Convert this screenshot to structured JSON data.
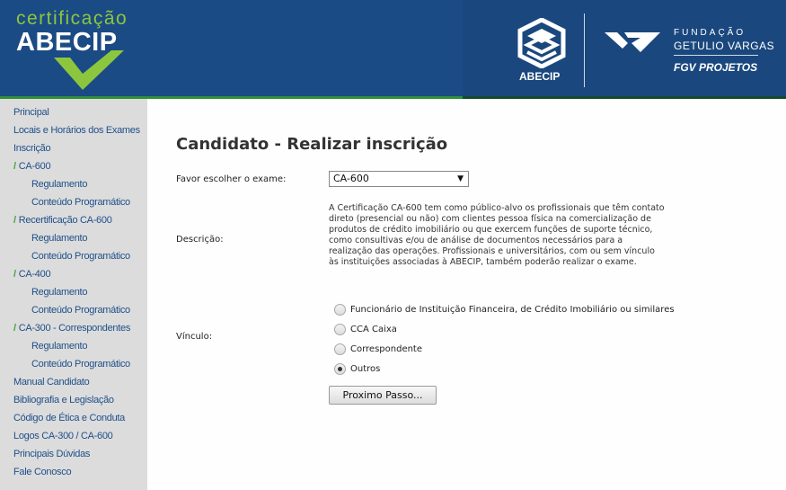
{
  "header": {
    "cert_small": "certificação",
    "cert_big": "ABECIP",
    "abecip_label": "ABECIP",
    "fgv_line1": "FUNDAÇÃO",
    "fgv_line2": "GETULIO VARGAS",
    "fgv_line3": "FGV PROJETOS"
  },
  "colors": {
    "header_blue": "#1b4b84",
    "brand_green": "#8cc63f",
    "nav_link": "#1f4f8a",
    "sidebar_bg": "#dcdcdc"
  },
  "sidebar": {
    "items": [
      {
        "label": "Principal",
        "level": 0,
        "checked": false
      },
      {
        "label": "Locais e Horários dos Exames",
        "level": 0,
        "checked": false
      },
      {
        "label": "Inscrição",
        "level": 0,
        "checked": false
      },
      {
        "label": "CA-600",
        "level": 0,
        "checked": true
      },
      {
        "label": "Regulamento",
        "level": 1,
        "checked": false
      },
      {
        "label": "Conteúdo Programático",
        "level": 1,
        "checked": false
      },
      {
        "label": "Recertificação CA-600",
        "level": 0,
        "checked": true
      },
      {
        "label": "Regulamento",
        "level": 1,
        "checked": false
      },
      {
        "label": "Conteúdo Programático",
        "level": 1,
        "checked": false
      },
      {
        "label": "CA-400",
        "level": 0,
        "checked": true
      },
      {
        "label": "Regulamento",
        "level": 1,
        "checked": false
      },
      {
        "label": "Conteúdo Programático",
        "level": 1,
        "checked": false
      },
      {
        "label": "CA-300 - Correspondentes",
        "level": 0,
        "checked": true
      },
      {
        "label": "Regulamento",
        "level": 1,
        "checked": false
      },
      {
        "label": "Conteúdo Programático",
        "level": 1,
        "checked": false
      },
      {
        "label": "Manual Candidato",
        "level": 0,
        "checked": false
      },
      {
        "label": "Bibliografia e Legislação",
        "level": 0,
        "checked": false
      },
      {
        "label": "Código de Ética e Conduta",
        "level": 0,
        "checked": false
      },
      {
        "label": "Logos CA-300 / CA-600",
        "level": 0,
        "checked": false
      },
      {
        "label": "Principais Dúvidas",
        "level": 0,
        "checked": false
      },
      {
        "label": "Fale Conosco",
        "level": 0,
        "checked": false
      }
    ]
  },
  "main": {
    "title": "Candidato - Realizar inscrição",
    "exam_label": "Favor escolher o exame:",
    "exam_selected": "CA-600",
    "description_label": "Descrição:",
    "description_text": "A Certificação CA-600 tem como público-alvo os profissionais que têm contato direto (presencial ou não) com clientes pessoa física na comercialização de produtos de crédito imobiliário ou que exercem funções de suporte técnico, como consultivas e/ou de análise de documentos necessários para a realização das operações. Profissionais e universitários, com ou sem vínculo às instituições associadas à ABECIP, também poderão realizar o exame.",
    "vinculo_label": "Vínculo:",
    "vinculo_options": [
      {
        "label": "Funcionário de Instituição Financeira, de Crédito Imobiliário ou similares",
        "checked": false
      },
      {
        "label": "CCA Caixa",
        "checked": false
      },
      {
        "label": "Correspondente",
        "checked": false
      },
      {
        "label": "Outros",
        "checked": true
      }
    ],
    "next_button": "Proximo Passo..."
  }
}
